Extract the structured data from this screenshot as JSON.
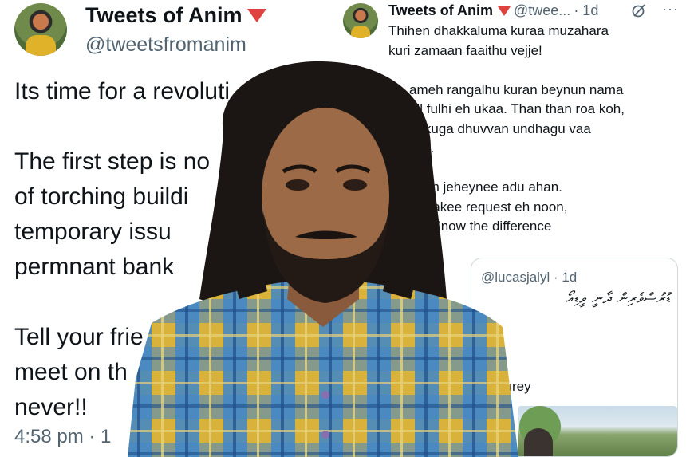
{
  "left_tweet": {
    "display_name": "Tweets of Anim",
    "handle": "@tweetsfromanim",
    "lines": [
      "Its time for a revoluti",
      "",
      "The first step is no",
      "of torching buildi",
      "temporary issu",
      "permnant bank",
      "",
      "Tell your frie",
      "meet on th",
      "never!!"
    ],
    "timestamp": "4:58 pm · 1"
  },
  "right_tweet": {
    "display_name": "Tweets of Anim",
    "handle": "@twee...",
    "time": "· 1d",
    "lines": [
      "Thihen dhakkaluma kuraa muzahara",
      "kuri zamaan faaithu vejje!",
      "",
      "ameh rangalhu kuran beynun nama",
      "oll fulhi eh ukaa. Than than roa koh,",
      "hakuga dhuvvan undhagu vaa",
      "olla.",
      "",
      "abun jeheynee adu ahan.",
      "raa akee request eh noon,",
      "eh! Know the difference"
    ],
    "quote": {
      "handle": "@lucasjalyl · 1d",
      "dhivehi_text": "ޑުރުސްވެރިން ދާނީ ވީޑިއޯ",
      "text": "eyrukurey"
    }
  },
  "icons": {
    "grok": "grok-icon",
    "more": "more-options-icon",
    "verified_marker": "red-triangle-icon"
  },
  "colors": {
    "text_primary": "#0f1419",
    "text_secondary": "#536471",
    "accent_triangle": "#e0433f"
  }
}
